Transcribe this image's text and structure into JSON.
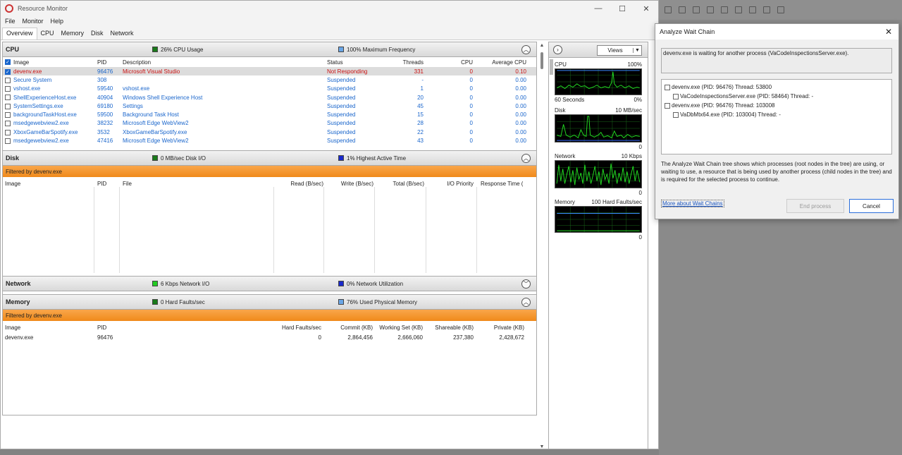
{
  "window": {
    "title": "Resource Monitor",
    "controls": [
      "—",
      "☐",
      "✕"
    ]
  },
  "menu": [
    "File",
    "Monitor",
    "Help"
  ],
  "tabs": [
    "Overview",
    "CPU",
    "Memory",
    "Disk",
    "Network"
  ],
  "cpu": {
    "title": "CPU",
    "stat1": "26% CPU Usage",
    "stat2": "100% Maximum Frequency",
    "stat1_color": "#1a7a1a",
    "stat2_color": "#6aa6e6",
    "headers": [
      "Image",
      "PID",
      "Description",
      "Status",
      "Threads",
      "CPU",
      "Average CPU"
    ],
    "rows": [
      {
        "image": "devenv.exe",
        "pid": "96476",
        "desc": "Microsoft Visual Studio",
        "status": "Not Responding",
        "threads": "331",
        "cpu": "0",
        "avg": "0.10",
        "checked": true
      },
      {
        "image": "Secure System",
        "pid": "308",
        "desc": "",
        "status": "Suspended",
        "threads": "-",
        "cpu": "0",
        "avg": "0.00",
        "checked": false
      },
      {
        "image": "vshost.exe",
        "pid": "59540",
        "desc": "vshost.exe",
        "status": "Suspended",
        "threads": "1",
        "cpu": "0",
        "avg": "0.00",
        "checked": false
      },
      {
        "image": "ShellExperienceHost.exe",
        "pid": "40904",
        "desc": "Windows Shell Experience Host",
        "status": "Suspended",
        "threads": "20",
        "cpu": "0",
        "avg": "0.00",
        "checked": false
      },
      {
        "image": "SystemSettings.exe",
        "pid": "69180",
        "desc": "Settings",
        "status": "Suspended",
        "threads": "45",
        "cpu": "0",
        "avg": "0.00",
        "checked": false
      },
      {
        "image": "backgroundTaskHost.exe",
        "pid": "59500",
        "desc": "Background Task Host",
        "status": "Suspended",
        "threads": "15",
        "cpu": "0",
        "avg": "0.00",
        "checked": false
      },
      {
        "image": "msedgewebview2.exe",
        "pid": "38232",
        "desc": "Microsoft Edge WebView2",
        "status": "Suspended",
        "threads": "28",
        "cpu": "0",
        "avg": "0.00",
        "checked": false
      },
      {
        "image": "XboxGameBarSpotify.exe",
        "pid": "3532",
        "desc": "XboxGameBarSpotify.exe",
        "status": "Suspended",
        "threads": "22",
        "cpu": "0",
        "avg": "0.00",
        "checked": false
      },
      {
        "image": "msedgewebview2.exe",
        "pid": "47416",
        "desc": "Microsoft Edge WebView2",
        "status": "Suspended",
        "threads": "43",
        "cpu": "0",
        "avg": "0.00",
        "checked": false
      }
    ]
  },
  "disk": {
    "title": "Disk",
    "stat1": "0 MB/sec Disk I/O",
    "stat2": "1% Highest Active Time",
    "stat1_color": "#1a7a1a",
    "stat2_color": "#1a2acc",
    "filter": "Filtered by devenv.exe",
    "headers": [
      "Image",
      "PID",
      "File",
      "Read (B/sec)",
      "Write (B/sec)",
      "Total (B/sec)",
      "I/O Priority",
      "Response Time (..."
    ]
  },
  "network": {
    "title": "Network",
    "stat1": "6 Kbps Network I/O",
    "stat2": "0% Network Utilization",
    "stat1_color": "#22cc22",
    "stat2_color": "#1a2acc"
  },
  "memory": {
    "title": "Memory",
    "stat1": "0 Hard Faults/sec",
    "stat2": "76% Used Physical Memory",
    "stat1_color": "#1a7a1a",
    "stat2_color": "#6aa6e6",
    "filter": "Filtered by devenv.exe",
    "headers": [
      "Image",
      "PID",
      "Hard Faults/sec",
      "Commit (KB)",
      "Working Set (KB)",
      "Shareable (KB)",
      "Private (KB)"
    ],
    "rows": [
      {
        "image": "devenv.exe",
        "pid": "96476",
        "faults": "0",
        "commit": "2,864,456",
        "ws": "2,666,060",
        "share": "237,380",
        "priv": "2,428,672"
      }
    ]
  },
  "graphs": {
    "views_label": "Views",
    "cpu": {
      "name": "CPU",
      "max": "100%",
      "left_foot": "60 Seconds",
      "right_foot": "0%"
    },
    "disk": {
      "name": "Disk",
      "max": "10 MB/sec",
      "right_foot": "0"
    },
    "network": {
      "name": "Network",
      "max": "10 Kbps",
      "right_foot": "0"
    },
    "memory": {
      "name": "Memory",
      "max": "100 Hard Faults/sec",
      "right_foot": "0"
    }
  },
  "dialog": {
    "title": "Analyze Wait Chain",
    "message": "devenv.exe is waiting for another process (VaCodeInspectionsServer.exe).",
    "tree": [
      {
        "label": "devenv.exe (PID: 96476) Thread: 53800",
        "level": 0
      },
      {
        "label": "VaCodeInspectionsServer.exe (PID: 58464) Thread: -",
        "level": 1
      },
      {
        "label": "devenv.exe (PID: 96476) Thread: 103008",
        "level": 0
      },
      {
        "label": "VaDbMtx64.exe (PID: 103004) Thread: -",
        "level": 1
      }
    ],
    "description": "The Analyze Wait Chain tree shows which processes (root nodes in the tree) are using, or waiting to use, a resource that is being used by another process (child nodes in the tree) and is required for the selected process to continue.",
    "link": "More about Wait Chains",
    "end_process": "End process",
    "cancel": "Cancel"
  }
}
